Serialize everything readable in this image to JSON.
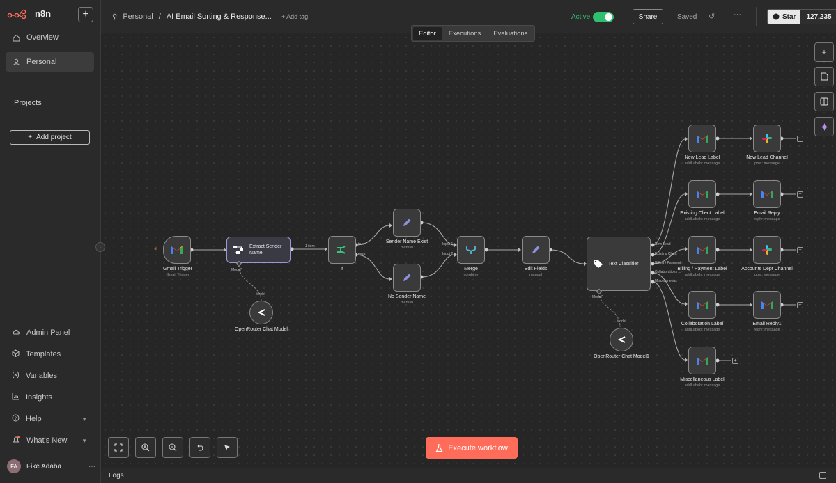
{
  "app": {
    "name": "n8n",
    "brand_color": "#ff6d5a"
  },
  "sidebar": {
    "nav": [
      {
        "label": "Overview",
        "icon": "home-icon"
      },
      {
        "label": "Personal",
        "icon": "user-icon"
      }
    ],
    "projects_label": "Projects",
    "add_project_label": "Add project",
    "bottom": [
      {
        "label": "Admin Panel",
        "icon": "cloud-icon"
      },
      {
        "label": "Templates",
        "icon": "box-icon"
      },
      {
        "label": "Variables",
        "icon": "variable-icon"
      },
      {
        "label": "Insights",
        "icon": "chart-icon"
      },
      {
        "label": "Help",
        "icon": "help-icon"
      },
      {
        "label": "What's New",
        "icon": "bell-icon"
      }
    ],
    "user": {
      "initials": "FA",
      "name": "Fike Adaba"
    }
  },
  "header": {
    "breadcrumb_project": "Personal",
    "workflow_name": "AI Email Sorting & Response...",
    "add_tag": "+ Add tag",
    "active_label": "Active",
    "share_label": "Share",
    "saved_label": "Saved",
    "star_label": "Star",
    "star_count": "127,235"
  },
  "tabs": [
    {
      "label": "Editor",
      "selected": true
    },
    {
      "label": "Executions",
      "selected": false
    },
    {
      "label": "Evaluations",
      "selected": false
    }
  ],
  "nodes": {
    "gmail_trigger": {
      "label": "Gmail Trigger",
      "sub": "Gmail Trigger"
    },
    "extract_sender": {
      "label": "Extract Sender Name"
    },
    "openrouter1": {
      "label": "OpenRouter Chat Model",
      "port": "Model"
    },
    "if": {
      "label": "If",
      "true_label": "true",
      "false_label": "false"
    },
    "sender_exist": {
      "label": "Sender Name Exist",
      "sub": "manual"
    },
    "no_sender": {
      "label": "No Sender Name",
      "sub": "manual"
    },
    "merge": {
      "label": "Merge",
      "sub": "combine",
      "in1": "Input 1",
      "in2": "Input 2"
    },
    "edit_fields": {
      "label": "Edit Fields",
      "sub": "manual"
    },
    "text_classifier": {
      "label": "Text Classifier",
      "outputs": [
        "New Lead",
        "Existing Client",
        "Billing / Payment",
        "Collaborations ...",
        "Miscellaneous"
      ]
    },
    "openrouter2": {
      "label": "OpenRouter Chat Model1",
      "port": "Model"
    },
    "new_lead_label": {
      "label": "New Lead Label",
      "sub": "addLabels: message"
    },
    "existing_client_label": {
      "label": "Existing Client Label",
      "sub": "addLabels: message"
    },
    "billing_label": {
      "label": "Billing / Payment Label",
      "sub": "addLabels: message"
    },
    "collab_label": {
      "label": "Collaboration Label",
      "sub": "addLabels: message"
    },
    "misc_label": {
      "label": "Miscellaneous Label",
      "sub": "addLabels: message"
    },
    "new_lead_channel": {
      "label": "New Lead Channel",
      "sub": "post: message"
    },
    "email_reply": {
      "label": "Email Reply",
      "sub": "reply: message"
    },
    "accounts_channel": {
      "label": "Accounts Dept Channel",
      "sub": "post: message"
    },
    "email_reply1": {
      "label": "Email Reply1",
      "sub": "reply: message"
    }
  },
  "edge_labels": {
    "one_item": "1 item",
    "model": "Model*",
    "model2": "Model*"
  },
  "execute_label": "Execute workflow",
  "logs_label": "Logs"
}
